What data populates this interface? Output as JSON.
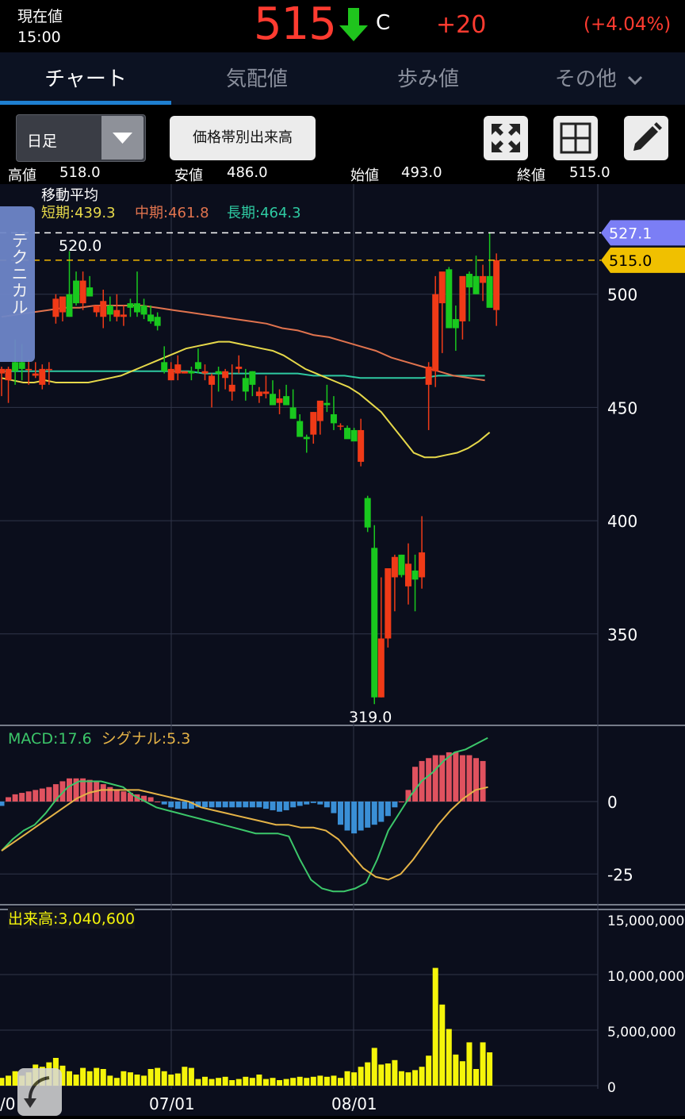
{
  "header": {
    "current_label": "現在値",
    "time": "15:00",
    "price": "515",
    "trend_icon": "down-arrow-icon",
    "flag": "C",
    "change": "+20",
    "change_pct": "(+4.04%)"
  },
  "tabs": [
    {
      "label": "チャート",
      "active": true
    },
    {
      "label": "気配値",
      "active": false
    },
    {
      "label": "歩み値",
      "active": false
    },
    {
      "label": "その他",
      "active": false
    }
  ],
  "toolbar": {
    "period": "日足",
    "volume_profile": "価格帯別出来高"
  },
  "ohlc": {
    "high_label": "高値",
    "high": "518.0",
    "low_label": "安値",
    "low": "486.0",
    "open_label": "始値",
    "open": "493.0",
    "close_label": "終値",
    "close": "515.0"
  },
  "side_tab": "テクニカル",
  "colors": {
    "up": "#f03a17",
    "down": "#19c81e",
    "short_ma": "#e6d84a",
    "mid_ma": "#e0734e",
    "long_ma": "#2ec9a1",
    "macd": "#3cc76a",
    "signal": "#e5b347",
    "volume": "#f5f50a"
  },
  "chart_data": [
    {
      "type": "candlestick",
      "ma_legend": {
        "title": "移動平均",
        "short": "短期:439.3",
        "mid": "中期:461.8",
        "long": "長期:464.3"
      },
      "ylim": [
        317,
        530
      ],
      "y_ticks": [
        "500",
        "450",
        "400",
        "350"
      ],
      "max_label": "520.0",
      "min_label": "319.0",
      "price_tags": [
        "527.1",
        "515.0"
      ],
      "x_ticks": [
        "/0",
        "07/01",
        "08/01"
      ],
      "candles": [
        [
          465,
          468,
          455,
          467
        ],
        [
          462,
          468,
          452,
          467
        ],
        [
          470,
          480,
          460,
          466
        ],
        [
          470,
          478,
          462,
          467
        ],
        [
          467,
          471,
          460,
          467
        ],
        [
          464,
          470,
          463,
          465
        ],
        [
          460,
          469,
          458,
          467
        ],
        [
          467,
          470,
          460,
          467
        ],
        [
          490,
          500,
          487,
          498
        ],
        [
          492,
          496,
          488,
          499
        ],
        [
          500,
          519,
          490,
          490
        ],
        [
          506,
          510,
          495,
          496
        ],
        [
          496,
          510,
          493,
          506
        ],
        [
          503,
          508,
          501,
          499
        ],
        [
          492,
          495,
          490,
          495
        ],
        [
          490,
          502,
          485,
          497
        ],
        [
          495,
          499,
          488,
          491
        ],
        [
          490,
          500,
          488,
          493
        ],
        [
          490,
          495,
          486,
          491
        ],
        [
          496,
          498,
          490,
          494
        ],
        [
          496,
          510,
          490,
          492
        ],
        [
          495,
          498,
          489,
          491
        ],
        [
          491,
          495,
          487,
          488
        ],
        [
          490,
          492,
          484,
          486
        ],
        [
          470,
          477,
          465,
          466
        ],
        [
          462,
          470,
          462,
          467
        ],
        [
          465,
          473,
          462,
          469
        ],
        [
          465,
          466,
          465,
          466
        ],
        [
          466,
          468,
          462,
          465
        ],
        [
          470,
          476,
          465,
          467
        ],
        [
          465,
          469,
          462,
          466
        ],
        [
          460,
          465,
          450,
          464
        ],
        [
          466,
          468,
          457,
          465
        ],
        [
          463,
          467,
          458,
          466
        ],
        [
          457,
          469,
          453,
          460
        ],
        [
          467,
          473,
          465,
          468
        ],
        [
          463,
          467,
          453,
          457
        ],
        [
          466,
          466,
          455,
          460
        ],
        [
          455,
          459,
          452,
          457
        ],
        [
          456,
          464,
          454,
          457
        ],
        [
          456,
          462,
          454,
          451
        ],
        [
          452,
          458,
          447,
          454
        ],
        [
          455,
          460,
          451,
          451
        ],
        [
          450,
          458,
          445,
          445
        ],
        [
          444,
          447,
          438,
          437
        ],
        [
          437,
          438,
          430,
          436
        ],
        [
          438,
          448,
          434,
          448
        ],
        [
          444,
          450,
          438,
          453
        ],
        [
          452,
          460,
          448,
          451
        ],
        [
          447,
          455,
          440,
          443
        ],
        [
          442,
          443,
          440,
          442
        ],
        [
          441,
          442,
          438,
          436
        ],
        [
          440,
          441,
          436,
          435
        ],
        [
          426,
          445,
          424,
          440
        ],
        [
          410,
          411,
          395,
          397
        ],
        [
          388,
          398,
          319,
          322
        ],
        [
          322,
          375,
          322,
          348
        ],
        [
          348,
          375,
          344,
          379
        ],
        [
          375,
          385,
          360,
          384
        ],
        [
          385,
          385,
          375,
          376
        ],
        [
          371,
          390,
          363,
          381
        ],
        [
          378,
          385,
          360,
          374
        ],
        [
          375,
          402,
          370,
          386
        ],
        [
          460,
          470,
          440,
          468
        ],
        [
          466,
          508,
          459,
          500
        ],
        [
          496,
          506,
          474,
          510
        ],
        [
          511,
          512,
          485,
          485
        ],
        [
          489,
          495,
          475,
          485
        ],
        [
          488,
          498,
          480,
          508
        ],
        [
          509,
          510,
          488,
          503
        ],
        [
          508,
          517,
          500,
          500
        ],
        [
          505,
          513,
          497,
          508
        ],
        [
          508,
          527,
          496,
          494
        ],
        [
          493,
          518,
          486,
          515
        ]
      ],
      "ma_short": [
        463,
        462,
        461,
        461,
        462,
        461,
        461,
        461,
        461,
        462,
        463,
        464,
        466,
        468,
        470,
        472,
        474,
        476,
        477,
        478,
        479,
        479,
        478,
        477,
        476,
        475,
        473,
        470,
        467,
        465,
        463,
        461,
        459,
        456,
        452,
        448,
        442,
        436,
        430,
        428,
        428,
        429,
        430,
        432,
        435,
        439
      ],
      "ma_mid": [
        490,
        491,
        492,
        493,
        494,
        494,
        495,
        495,
        495,
        495,
        494,
        493,
        492,
        491,
        490,
        489,
        488,
        487,
        485,
        484,
        482,
        481,
        479,
        477,
        475,
        472,
        470,
        468,
        466,
        464,
        463,
        462
      ],
      "ma_long": [
        466,
        466,
        466,
        466,
        466,
        466,
        466,
        466,
        466,
        466,
        466,
        466,
        466,
        465,
        465,
        465,
        465,
        465,
        465,
        465,
        464,
        464,
        464,
        463,
        463,
        463,
        463,
        463,
        464,
        464,
        464,
        464
      ]
    },
    {
      "type": "bar",
      "title": "MACD",
      "macd_label": "MACD:17.6",
      "signal_label": "シグナル:5.3",
      "ylim": [
        -30,
        20
      ],
      "y_ticks": [
        "0",
        "-25"
      ],
      "histogram": [
        -1.5,
        1.5,
        2.5,
        3,
        3.5,
        4,
        4.5,
        5,
        6,
        7,
        8,
        8,
        8,
        7.5,
        7,
        6,
        5,
        4,
        3.5,
        3,
        2.5,
        2,
        1.5,
        0,
        -1,
        -2,
        -2.5,
        -2.5,
        -2.5,
        -2,
        -2,
        -2,
        -2,
        -2,
        -2,
        -2,
        -2,
        -2,
        -2,
        -2.5,
        -3,
        -3.5,
        -3,
        -2,
        -1.5,
        -1,
        -0.5,
        -1,
        -2,
        -4,
        -8,
        -10,
        -11,
        -10,
        -9,
        -8,
        -7,
        -5,
        -2,
        0,
        4,
        12,
        14,
        15,
        16,
        16,
        17,
        17,
        16,
        16,
        15,
        14
      ],
      "macd": [
        -17,
        -13,
        -10,
        -8,
        -4,
        1,
        5,
        7,
        7,
        7,
        6,
        5,
        2,
        0,
        -2,
        -3,
        -4,
        -5,
        -6,
        -7,
        -8,
        -9,
        -10,
        -11,
        -11,
        -11,
        -12,
        -20,
        -27,
        -30,
        -31,
        -31,
        -30,
        -28,
        -20,
        -10,
        -4,
        2,
        7,
        10,
        14,
        17,
        18,
        20,
        22
      ],
      "signal": [
        -17,
        -14,
        -11,
        -8,
        -5,
        -2,
        1,
        3,
        4,
        4,
        4,
        4,
        3,
        2,
        1,
        0,
        -2,
        -3,
        -4,
        -5,
        -6,
        -7,
        -8,
        -8,
        -9,
        -9,
        -10,
        -13,
        -18,
        -23,
        -26,
        -27,
        -25,
        -20,
        -14,
        -8,
        -3,
        1,
        4,
        5
      ]
    },
    {
      "type": "bar",
      "title": "出来高",
      "volume_label": "出来高:3,040,600",
      "ylim": [
        0,
        15000000
      ],
      "y_ticks": [
        "15,000,000",
        "10,000,000",
        "5,000,000",
        "0"
      ],
      "values": [
        700000,
        900000,
        1300000,
        900000,
        1200000,
        1900000,
        1700000,
        2100000,
        2500000,
        1800000,
        1300000,
        1000000,
        1600000,
        1300000,
        1600000,
        1500000,
        900000,
        700000,
        1300000,
        1200000,
        1000000,
        900000,
        1500000,
        1600000,
        1300000,
        1000000,
        1100000,
        1700000,
        1600000,
        600000,
        800000,
        600000,
        700000,
        800000,
        500000,
        600000,
        800000,
        700000,
        1000000,
        600000,
        700000,
        500000,
        600000,
        700000,
        800000,
        700000,
        800000,
        900000,
        800000,
        900000,
        700000,
        1300000,
        1200000,
        1700000,
        2100000,
        3400000,
        1900000,
        2000000,
        2300000,
        1300000,
        1200000,
        1400000,
        1700000,
        2700000,
        10600000,
        7300000,
        5100000,
        2800000,
        2200000,
        3900000,
        1500000,
        3900000,
        3000000
      ]
    }
  ]
}
